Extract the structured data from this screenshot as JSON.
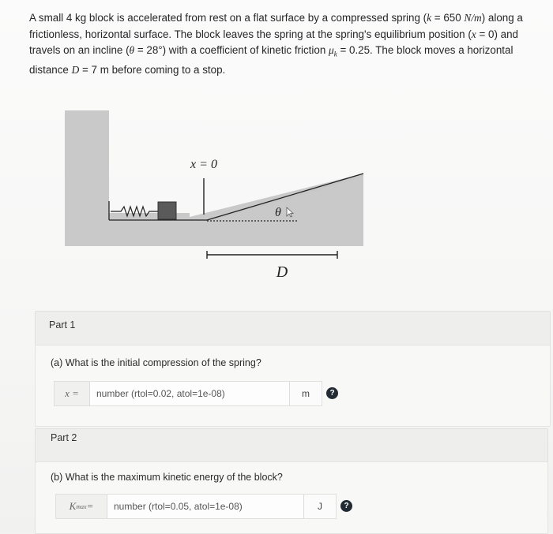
{
  "problem": {
    "line1_a": "A small 4 kg block is accelerated from rest on a flat surface by a compressed spring (",
    "k_sym": "k",
    "line1_b": " = 650 ",
    "unit_k": "N/m",
    "line1_c": ") along a",
    "line2_a": "frictionless, horizontal surface. The block leaves the spring at the spring's equilibrium position (",
    "x_sym": "x",
    "line2_b": " = 0) and",
    "line3_a": "travels on an incline (",
    "theta_sym": "θ",
    "line3_b": " = 28°) with a coefficient of kinetic friction ",
    "mu_sym": "μ",
    "mu_sub": "k",
    "line3_c": " = 0.25. The block moves a horizontal",
    "line4_a": "distance ",
    "D_sym": "D",
    "line4_b": " = 7 m before coming to a stop."
  },
  "figure": {
    "x_label": "x = 0",
    "theta_label": "θ",
    "D_label": "D"
  },
  "parts": [
    {
      "label": "Part 1",
      "question": "(a) What is the initial compression of the spring?",
      "variable": "x =",
      "placeholder": "number (rtol=0.02, atol=1e-08)",
      "unit": "m",
      "help": "?"
    },
    {
      "label": "Part 2",
      "question": "(b) What is the maximum kinetic energy of the block?",
      "variable_main": "K",
      "variable_sub": "max",
      "variable_eq": " =",
      "placeholder": "number (rtol=0.05, atol=1e-08)",
      "unit": "J",
      "help": "?"
    }
  ],
  "colors": {
    "figure_gray": "#c9c9c9",
    "block": "#5a5a5a",
    "help_bg": "#222a33"
  }
}
